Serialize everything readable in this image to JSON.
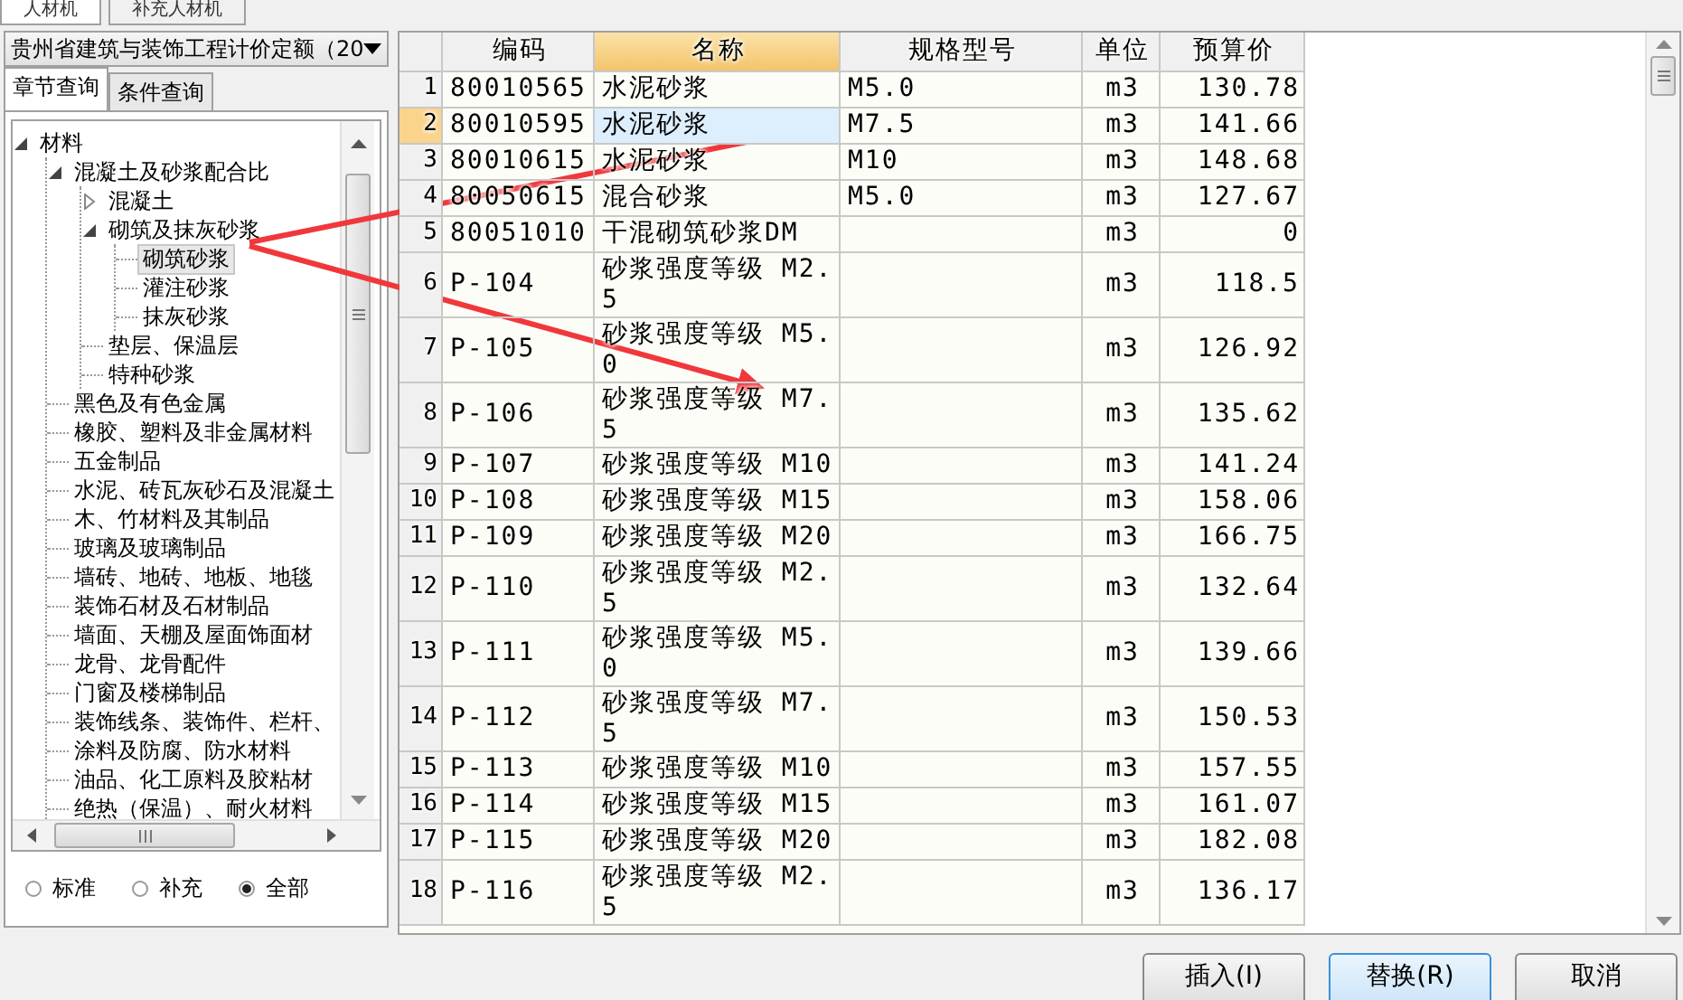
{
  "top_tabs": [
    {
      "label": "人材机",
      "selected": true
    },
    {
      "label": "补充人材机",
      "selected": false
    }
  ],
  "library_select": {
    "value": "贵州省建筑与装饰工程计价定额（20"
  },
  "query_tabs": [
    {
      "label": "章节查询",
      "selected": true
    },
    {
      "label": "条件查询",
      "selected": false
    }
  ],
  "tree": [
    {
      "label": "材料",
      "expanded": true,
      "selected": false,
      "children": [
        {
          "label": "混凝土及砂浆配合比",
          "expanded": true,
          "selected": false,
          "children": [
            {
              "label": "混凝土",
              "expanded": false,
              "selected": false
            },
            {
              "label": "砌筑及抹灰砂浆",
              "expanded": true,
              "selected": false,
              "children": [
                {
                  "label": "砌筑砂浆",
                  "selected": true
                },
                {
                  "label": "灌注砂浆",
                  "selected": false
                },
                {
                  "label": "抹灰砂浆",
                  "selected": false
                }
              ]
            },
            {
              "label": "垫层、保温层",
              "selected": false
            },
            {
              "label": "特种砂浆",
              "selected": false
            }
          ]
        },
        {
          "label": "黑色及有色金属",
          "selected": false
        },
        {
          "label": "橡胶、塑料及非金属材料",
          "selected": false
        },
        {
          "label": "五金制品",
          "selected": false
        },
        {
          "label": "水泥、砖瓦灰砂石及混凝土",
          "selected": false
        },
        {
          "label": "木、竹材料及其制品",
          "selected": false
        },
        {
          "label": "玻璃及玻璃制品",
          "selected": false
        },
        {
          "label": "墙砖、地砖、地板、地毯",
          "selected": false
        },
        {
          "label": "装饰石材及石材制品",
          "selected": false
        },
        {
          "label": "墙面、天棚及屋面饰面材",
          "selected": false
        },
        {
          "label": "龙骨、龙骨配件",
          "selected": false
        },
        {
          "label": "门窗及楼梯制品",
          "selected": false
        },
        {
          "label": "装饰线条、装饰件、栏杆、",
          "selected": false
        },
        {
          "label": "涂料及防腐、防水材料",
          "selected": false
        },
        {
          "label": "油品、化工原料及胶粘材",
          "selected": false
        },
        {
          "label": "绝热（保温）、耐火材料",
          "selected": false
        }
      ]
    }
  ],
  "filter": [
    {
      "label": "标准",
      "selected": false
    },
    {
      "label": "补充",
      "selected": false
    },
    {
      "label": "全部",
      "selected": true
    }
  ],
  "table": {
    "columns": [
      {
        "label": "编码",
        "selected": false
      },
      {
        "label": "名称",
        "selected": true
      },
      {
        "label": "规格型号",
        "selected": false
      },
      {
        "label": "单位",
        "selected": false
      },
      {
        "label": "预算价",
        "selected": false
      }
    ],
    "rows": [
      {
        "no": "1",
        "code": "80010565",
        "name": "水泥砂浆",
        "spec": "M5.0",
        "unit": "m3",
        "price": "130.78",
        "selected": false
      },
      {
        "no": "2",
        "code": "80010595",
        "name": "水泥砂浆",
        "spec": "M7.5",
        "unit": "m3",
        "price": "141.66",
        "selected": true
      },
      {
        "no": "3",
        "code": "80010615",
        "name": "水泥砂浆",
        "spec": "M10",
        "unit": "m3",
        "price": "148.68",
        "selected": false
      },
      {
        "no": "4",
        "code": "80050615",
        "name": "混合砂浆",
        "spec": "M5.0",
        "unit": "m3",
        "price": "127.67",
        "selected": false
      },
      {
        "no": "5",
        "code": "80051010",
        "name": "干混砌筑砂浆DM",
        "spec": "",
        "unit": "m3",
        "price": "0",
        "selected": false
      },
      {
        "no": "6",
        "code": "P-104",
        "name": "砂浆强度等级 M2.5",
        "unit": "m3",
        "price": "118.5",
        "selected": false
      },
      {
        "no": "7",
        "code": "P-105",
        "name": "砂浆强度等级 M5.0",
        "unit": "m3",
        "price": "126.92",
        "selected": false
      },
      {
        "no": "8",
        "code": "P-106",
        "name": "砂浆强度等级 M7.5",
        "unit": "m3",
        "price": "135.62",
        "selected": false
      },
      {
        "no": "9",
        "code": "P-107",
        "name": "砂浆强度等级 M10",
        "unit": "m3",
        "price": "141.24",
        "selected": false
      },
      {
        "no": "10",
        "code": "P-108",
        "name": "砂浆强度等级 M15",
        "unit": "m3",
        "price": "158.06",
        "selected": false
      },
      {
        "no": "11",
        "code": "P-109",
        "name": "砂浆强度等级 M20",
        "unit": "m3",
        "price": "166.75",
        "selected": false
      },
      {
        "no": "12",
        "code": "P-110",
        "name": "砂浆强度等级 M2.5",
        "unit": "m3",
        "price": "132.64",
        "selected": false
      },
      {
        "no": "13",
        "code": "P-111",
        "name": "砂浆强度等级 M5.0",
        "unit": "m3",
        "price": "139.66",
        "selected": false
      },
      {
        "no": "14",
        "code": "P-112",
        "name": "砂浆强度等级 M7.5",
        "unit": "m3",
        "price": "150.53",
        "selected": false
      },
      {
        "no": "15",
        "code": "P-113",
        "name": "砂浆强度等级 M10",
        "unit": "m3",
        "price": "157.55",
        "selected": false
      },
      {
        "no": "16",
        "code": "P-114",
        "name": "砂浆强度等级 M15",
        "unit": "m3",
        "price": "161.07",
        "selected": false
      },
      {
        "no": "17",
        "code": "P-115",
        "name": "砂浆强度等级 M20",
        "unit": "m3",
        "price": "182.08",
        "selected": false
      },
      {
        "no": "18",
        "code": "P-116",
        "name": "砂浆强度等级 M2.5",
        "unit": "m3",
        "price": "136.17",
        "selected": false
      }
    ]
  },
  "buttons": [
    {
      "label": "插入(I)",
      "selected": false
    },
    {
      "label": "替换(R)",
      "selected": true
    },
    {
      "label": "取消",
      "selected": false
    }
  ]
}
